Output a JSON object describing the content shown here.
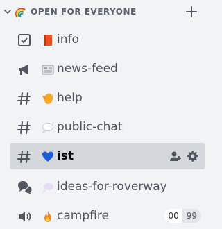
{
  "category": {
    "label": "OPEN FOR EVERYONE",
    "emoji": "rainbow",
    "add_icon": "plus-icon"
  },
  "channels": [
    {
      "name": "info",
      "type": "rules",
      "emoji": "orange-book"
    },
    {
      "name": "news-feed",
      "type": "announcement",
      "emoji": "newspaper"
    },
    {
      "name": "help",
      "type": "text",
      "emoji": "raised-hand"
    },
    {
      "name": "public-chat",
      "type": "text",
      "emoji": "speech-balloon"
    },
    {
      "name": "ist",
      "type": "text",
      "emoji": "blue-heart",
      "selected": true,
      "actions": [
        "add-member-icon",
        "gear-icon"
      ]
    },
    {
      "name": "ideas-for-roverway",
      "type": "forum",
      "emoji": "thought-balloon"
    },
    {
      "name": "campfire",
      "type": "voice",
      "emoji": "fire",
      "count_left": "00",
      "count_right": "99"
    }
  ],
  "colors": {
    "background": "#f2f3f5",
    "selected_background": "#d4d7dc",
    "icon": "#4f5660",
    "blue_heart": "#1e5bd6",
    "fire": "#f08a24",
    "orange_book": "#e8521f"
  }
}
